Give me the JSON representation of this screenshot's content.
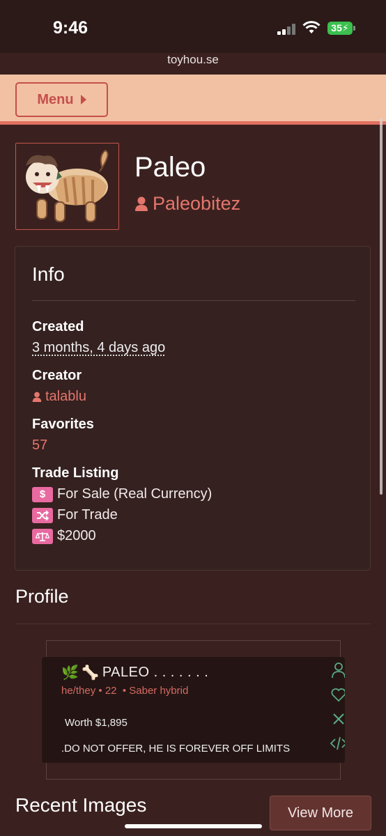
{
  "status_bar": {
    "time": "9:46",
    "battery": "35"
  },
  "browser": {
    "url": "toyhou.se"
  },
  "menu": {
    "label": "Menu"
  },
  "character": {
    "name": "Paleo",
    "owner": "Paleobitez"
  },
  "info": {
    "title": "Info",
    "created_label": "Created",
    "created_value": "3 months, 4 days ago",
    "creator_label": "Creator",
    "creator_value": "talablu",
    "favorites_label": "Favorites",
    "favorites_value": "57",
    "trade_label": "Trade Listing",
    "trade_items": [
      {
        "icon": "dollar-icon",
        "text": "For Sale (Real Currency)"
      },
      {
        "icon": "shuffle-icon",
        "text": "For Trade"
      },
      {
        "icon": "scale-icon",
        "text": "$2000"
      }
    ]
  },
  "profile": {
    "title": "Profile",
    "name": "PALEO . . . . . . .",
    "pronouns": "he/they",
    "age": "22",
    "species": "Saber hybrid",
    "worth": "Worth $1,895",
    "note": ".DO NOT OFFER, HE IS FOREVER OFF LIMITS"
  },
  "recent_images": {
    "title": "Recent Images",
    "view_more": "View More"
  },
  "colors": {
    "accent": "#e5766c",
    "background": "#3a211f",
    "menu_bar": "#f2c1a4",
    "badge": "#e86aa0"
  }
}
